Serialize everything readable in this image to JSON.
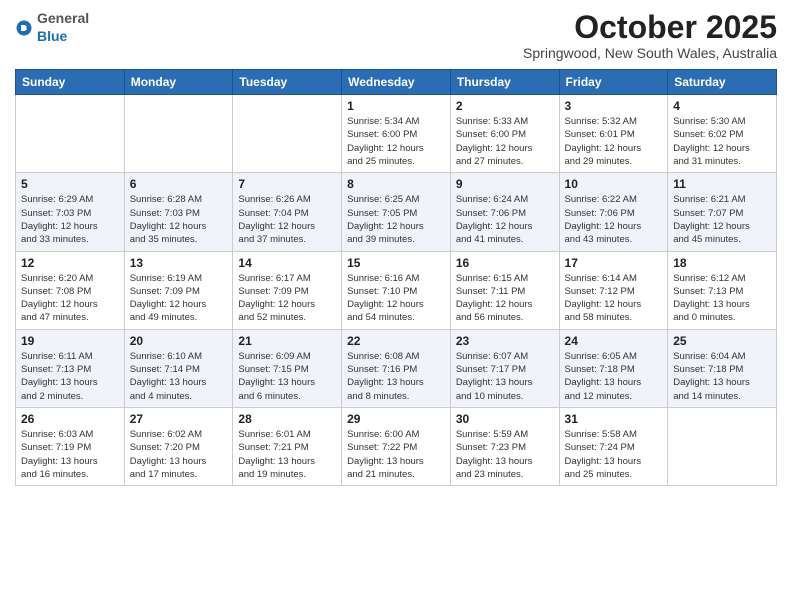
{
  "header": {
    "logo": {
      "general": "General",
      "blue": "Blue"
    },
    "title": "October 2025",
    "subtitle": "Springwood, New South Wales, Australia"
  },
  "weekdays": [
    "Sunday",
    "Monday",
    "Tuesday",
    "Wednesday",
    "Thursday",
    "Friday",
    "Saturday"
  ],
  "weeks": [
    [
      {
        "day": "",
        "text": ""
      },
      {
        "day": "",
        "text": ""
      },
      {
        "day": "",
        "text": ""
      },
      {
        "day": "1",
        "text": "Sunrise: 5:34 AM\nSunset: 6:00 PM\nDaylight: 12 hours\nand 25 minutes."
      },
      {
        "day": "2",
        "text": "Sunrise: 5:33 AM\nSunset: 6:00 PM\nDaylight: 12 hours\nand 27 minutes."
      },
      {
        "day": "3",
        "text": "Sunrise: 5:32 AM\nSunset: 6:01 PM\nDaylight: 12 hours\nand 29 minutes."
      },
      {
        "day": "4",
        "text": "Sunrise: 5:30 AM\nSunset: 6:02 PM\nDaylight: 12 hours\nand 31 minutes."
      }
    ],
    [
      {
        "day": "5",
        "text": "Sunrise: 6:29 AM\nSunset: 7:03 PM\nDaylight: 12 hours\nand 33 minutes."
      },
      {
        "day": "6",
        "text": "Sunrise: 6:28 AM\nSunset: 7:03 PM\nDaylight: 12 hours\nand 35 minutes."
      },
      {
        "day": "7",
        "text": "Sunrise: 6:26 AM\nSunset: 7:04 PM\nDaylight: 12 hours\nand 37 minutes."
      },
      {
        "day": "8",
        "text": "Sunrise: 6:25 AM\nSunset: 7:05 PM\nDaylight: 12 hours\nand 39 minutes."
      },
      {
        "day": "9",
        "text": "Sunrise: 6:24 AM\nSunset: 7:06 PM\nDaylight: 12 hours\nand 41 minutes."
      },
      {
        "day": "10",
        "text": "Sunrise: 6:22 AM\nSunset: 7:06 PM\nDaylight: 12 hours\nand 43 minutes."
      },
      {
        "day": "11",
        "text": "Sunrise: 6:21 AM\nSunset: 7:07 PM\nDaylight: 12 hours\nand 45 minutes."
      }
    ],
    [
      {
        "day": "12",
        "text": "Sunrise: 6:20 AM\nSunset: 7:08 PM\nDaylight: 12 hours\nand 47 minutes."
      },
      {
        "day": "13",
        "text": "Sunrise: 6:19 AM\nSunset: 7:09 PM\nDaylight: 12 hours\nand 49 minutes."
      },
      {
        "day": "14",
        "text": "Sunrise: 6:17 AM\nSunset: 7:09 PM\nDaylight: 12 hours\nand 52 minutes."
      },
      {
        "day": "15",
        "text": "Sunrise: 6:16 AM\nSunset: 7:10 PM\nDaylight: 12 hours\nand 54 minutes."
      },
      {
        "day": "16",
        "text": "Sunrise: 6:15 AM\nSunset: 7:11 PM\nDaylight: 12 hours\nand 56 minutes."
      },
      {
        "day": "17",
        "text": "Sunrise: 6:14 AM\nSunset: 7:12 PM\nDaylight: 12 hours\nand 58 minutes."
      },
      {
        "day": "18",
        "text": "Sunrise: 6:12 AM\nSunset: 7:13 PM\nDaylight: 13 hours\nand 0 minutes."
      }
    ],
    [
      {
        "day": "19",
        "text": "Sunrise: 6:11 AM\nSunset: 7:13 PM\nDaylight: 13 hours\nand 2 minutes."
      },
      {
        "day": "20",
        "text": "Sunrise: 6:10 AM\nSunset: 7:14 PM\nDaylight: 13 hours\nand 4 minutes."
      },
      {
        "day": "21",
        "text": "Sunrise: 6:09 AM\nSunset: 7:15 PM\nDaylight: 13 hours\nand 6 minutes."
      },
      {
        "day": "22",
        "text": "Sunrise: 6:08 AM\nSunset: 7:16 PM\nDaylight: 13 hours\nand 8 minutes."
      },
      {
        "day": "23",
        "text": "Sunrise: 6:07 AM\nSunset: 7:17 PM\nDaylight: 13 hours\nand 10 minutes."
      },
      {
        "day": "24",
        "text": "Sunrise: 6:05 AM\nSunset: 7:18 PM\nDaylight: 13 hours\nand 12 minutes."
      },
      {
        "day": "25",
        "text": "Sunrise: 6:04 AM\nSunset: 7:18 PM\nDaylight: 13 hours\nand 14 minutes."
      }
    ],
    [
      {
        "day": "26",
        "text": "Sunrise: 6:03 AM\nSunset: 7:19 PM\nDaylight: 13 hours\nand 16 minutes."
      },
      {
        "day": "27",
        "text": "Sunrise: 6:02 AM\nSunset: 7:20 PM\nDaylight: 13 hours\nand 17 minutes."
      },
      {
        "day": "28",
        "text": "Sunrise: 6:01 AM\nSunset: 7:21 PM\nDaylight: 13 hours\nand 19 minutes."
      },
      {
        "day": "29",
        "text": "Sunrise: 6:00 AM\nSunset: 7:22 PM\nDaylight: 13 hours\nand 21 minutes."
      },
      {
        "day": "30",
        "text": "Sunrise: 5:59 AM\nSunset: 7:23 PM\nDaylight: 13 hours\nand 23 minutes."
      },
      {
        "day": "31",
        "text": "Sunrise: 5:58 AM\nSunset: 7:24 PM\nDaylight: 13 hours\nand 25 minutes."
      },
      {
        "day": "",
        "text": ""
      }
    ]
  ]
}
